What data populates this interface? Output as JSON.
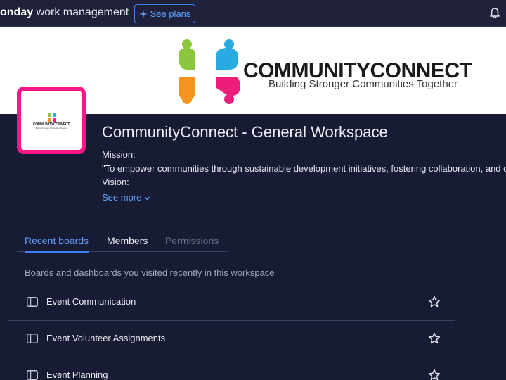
{
  "topbar": {
    "brand_bold": "onday",
    "brand_rest": " work management",
    "see_plans_label": "See plans",
    "icons": [
      "sparkle-icon",
      "bell-icon"
    ]
  },
  "banner": {
    "logo_title": "COMMUNITYCONNECT",
    "logo_subtitle": "Building Stronger Communities Together",
    "logo_colors": [
      "#8cc63f",
      "#29abe2",
      "#f7931e",
      "#ed1e79"
    ]
  },
  "avatar": {
    "text": "COMMUNITYCONNECT",
    "subtext": "Building Stronger Communities Together",
    "frame_color": "#ff158a"
  },
  "workspace": {
    "title": "CommunityConnect - General Workspace",
    "mission_label": "Mission:",
    "mission_text": "\"To empower communities through sustainable development initiatives, fostering collaboration, and c",
    "vision_label": "Vision:",
    "see_more": "See more"
  },
  "tabs": [
    {
      "label": "Recent boards",
      "state": "active"
    },
    {
      "label": "Members",
      "state": "normal"
    },
    {
      "label": "Permissions",
      "state": "disabled"
    }
  ],
  "recent": {
    "hint": "Boards and dashboards you visited recently in this workspace",
    "boards": [
      {
        "label": "Event Communication",
        "icon": "board-icon",
        "starred": false
      },
      {
        "label": "Event Volunteer Assignments",
        "icon": "board-icon",
        "starred": false
      },
      {
        "label": "Event Planning",
        "icon": "board-icon",
        "starred": false
      }
    ]
  },
  "colors": {
    "accent": "#3b82f6",
    "background": "#181b34"
  }
}
